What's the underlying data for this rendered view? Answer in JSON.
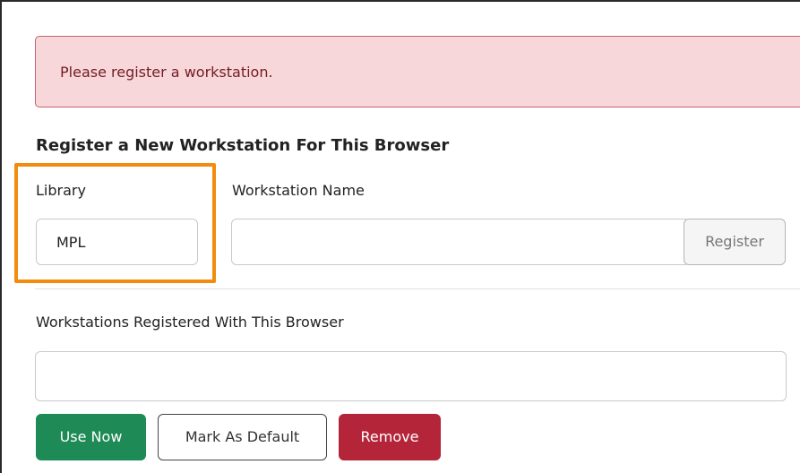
{
  "alert": {
    "message": "Please register a workstation."
  },
  "register_section": {
    "title": "Register a New Workstation For This Browser",
    "library_label": "Library",
    "library_value": "MPL",
    "workstation_name_label": "Workstation Name",
    "workstation_name_value": "",
    "register_button": "Register"
  },
  "registered_section": {
    "label": "Workstations Registered With This Browser",
    "selected_value": ""
  },
  "actions": {
    "use_now": "Use Now",
    "mark_default": "Mark As Default",
    "remove": "Remove"
  },
  "colors": {
    "alert_bg": "#f8d7da",
    "highlight": "#f28c0f",
    "success": "#1e8a55",
    "danger": "#b4253a"
  }
}
